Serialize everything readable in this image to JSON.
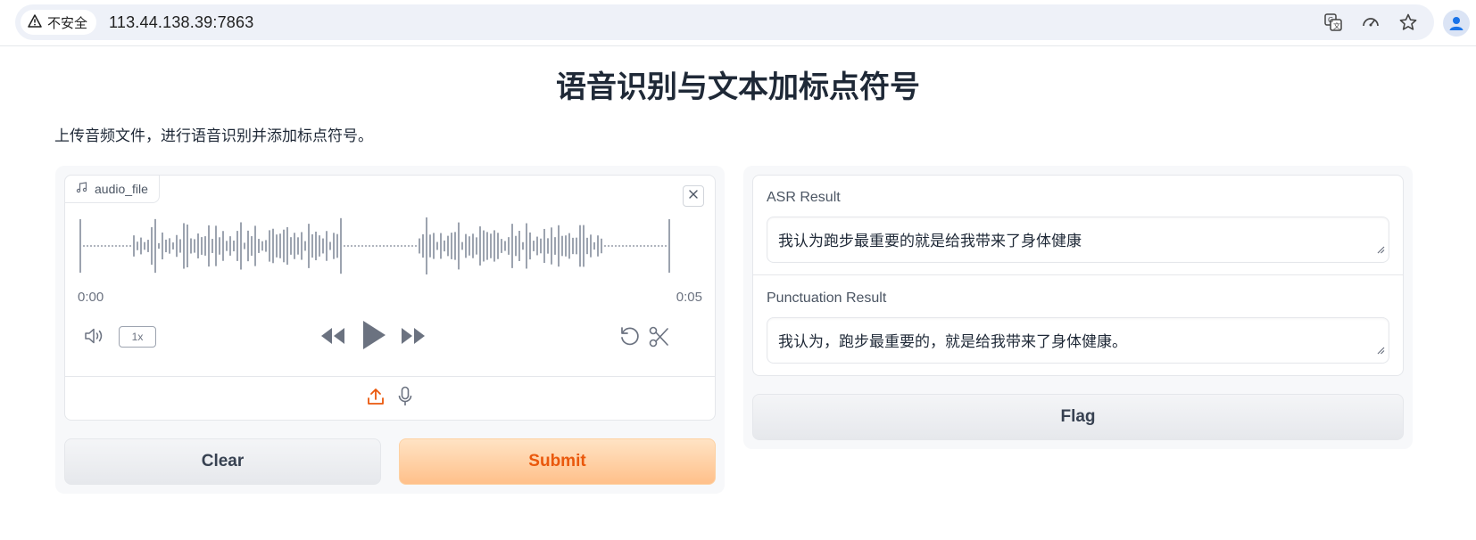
{
  "browser": {
    "security_label": "不安全",
    "url": "113.44.138.39:7863",
    "icons": [
      "warning-icon",
      "translate-icon",
      "performance-icon",
      "bookmark-star-icon",
      "profile-icon"
    ]
  },
  "page": {
    "title": "语音识别与文本加标点符号",
    "description": "上传音频文件，进行语音识别并添加标点符号。"
  },
  "audio": {
    "label": "audio_file",
    "time_current": "0:00",
    "time_total": "0:05",
    "playback_speed": "1x",
    "icons": [
      "music-note-icon",
      "close-icon",
      "volume-icon",
      "rewind-icon",
      "play-icon",
      "fast-forward-icon",
      "reset-icon",
      "scissors-icon",
      "upload-icon",
      "microphone-icon"
    ]
  },
  "buttons": {
    "clear": "Clear",
    "submit": "Submit",
    "flag": "Flag"
  },
  "results": {
    "asr_label": "ASR Result",
    "asr_value": "我认为跑步最重要的就是给我带来了身体健康",
    "punct_label": "Punctuation Result",
    "punct_value": "我认为，跑步最重要的，就是给我带来了身体健康。"
  },
  "colors": {
    "accent": "#ea580c",
    "submit_bg": "#ffc08a",
    "waveform": "#9ca3af"
  }
}
